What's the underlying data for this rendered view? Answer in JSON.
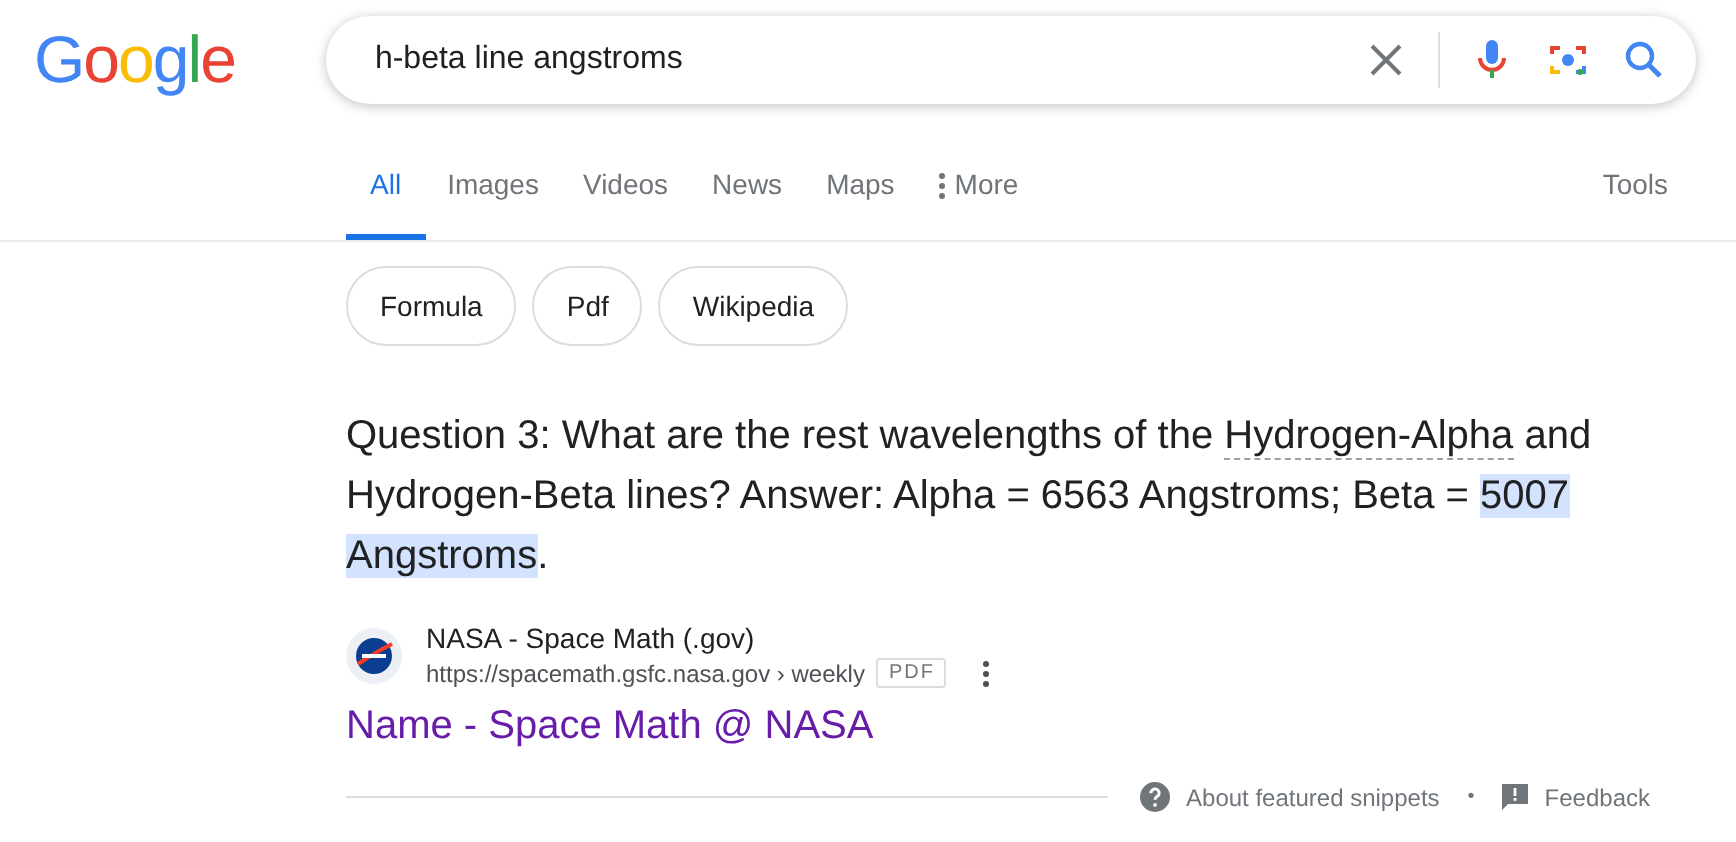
{
  "logo": "Google",
  "search": {
    "value": "h-beta line angstroms"
  },
  "tabs": [
    {
      "label": "All",
      "selected": true
    },
    {
      "label": "Images",
      "selected": false
    },
    {
      "label": "Videos",
      "selected": false
    },
    {
      "label": "News",
      "selected": false
    },
    {
      "label": "Maps",
      "selected": false
    },
    {
      "label": "More",
      "selected": false,
      "kind": "menu"
    }
  ],
  "tools": "Tools",
  "chips": [
    "Formula",
    "Pdf",
    "Wikipedia"
  ],
  "snippet": [
    {
      "kind": "plain",
      "text": "Question 3: What are the rest wavelengths of the "
    },
    {
      "kind": "defined",
      "text": "Hydrogen-Alpha"
    },
    {
      "kind": "plain",
      "text": " and Hydrogen-Beta lines? Answer: Alpha = 6563 Angstroms; Beta = "
    },
    {
      "kind": "highlight",
      "text": "5007 Angstroms"
    },
    {
      "kind": "plain",
      "text": "."
    }
  ],
  "source": {
    "site": "NASA - Space Math (.gov)",
    "url": "https://spacemath.gsfc.nasa.gov › weekly",
    "tag": "PDF"
  },
  "result_title": "Name - Space Math @ NASA",
  "footer": {
    "about": "About featured snippets",
    "separator": "•",
    "feedback": "Feedback"
  }
}
